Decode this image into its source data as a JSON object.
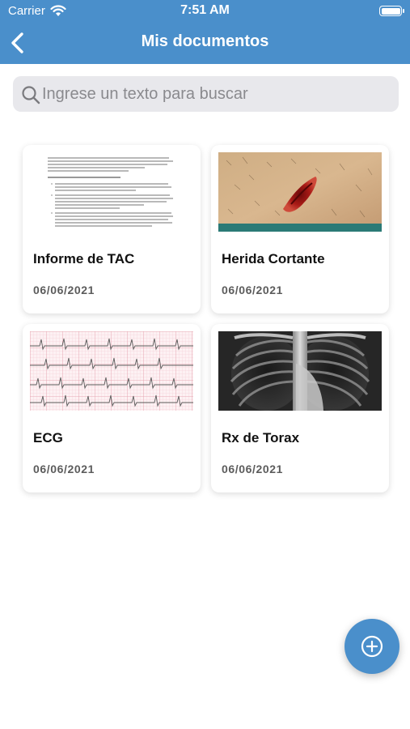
{
  "status_bar": {
    "carrier": "Carrier",
    "time": "7:51 AM"
  },
  "header": {
    "title": "Mis documentos"
  },
  "search": {
    "placeholder": "Ingrese un texto para buscar"
  },
  "documents": [
    {
      "name": "Informe de TAC",
      "date": "06/06/2021",
      "thumbnail": "report-text-page"
    },
    {
      "name": "Herida Cortante",
      "date": "06/06/2021",
      "thumbnail": "wound-photo"
    },
    {
      "name": "ECG",
      "date": "06/06/2021",
      "thumbnail": "ecg-trace"
    },
    {
      "name": "Rx de Torax",
      "date": "06/06/2021",
      "thumbnail": "chest-xray"
    }
  ],
  "icons": {
    "back": "chevron-left-icon",
    "search": "search-icon",
    "add": "plus-circle-icon"
  },
  "colors": {
    "primary": "#4a8fcb",
    "search_bg": "#e8e8ec",
    "date_text": "#5c5c5c"
  }
}
